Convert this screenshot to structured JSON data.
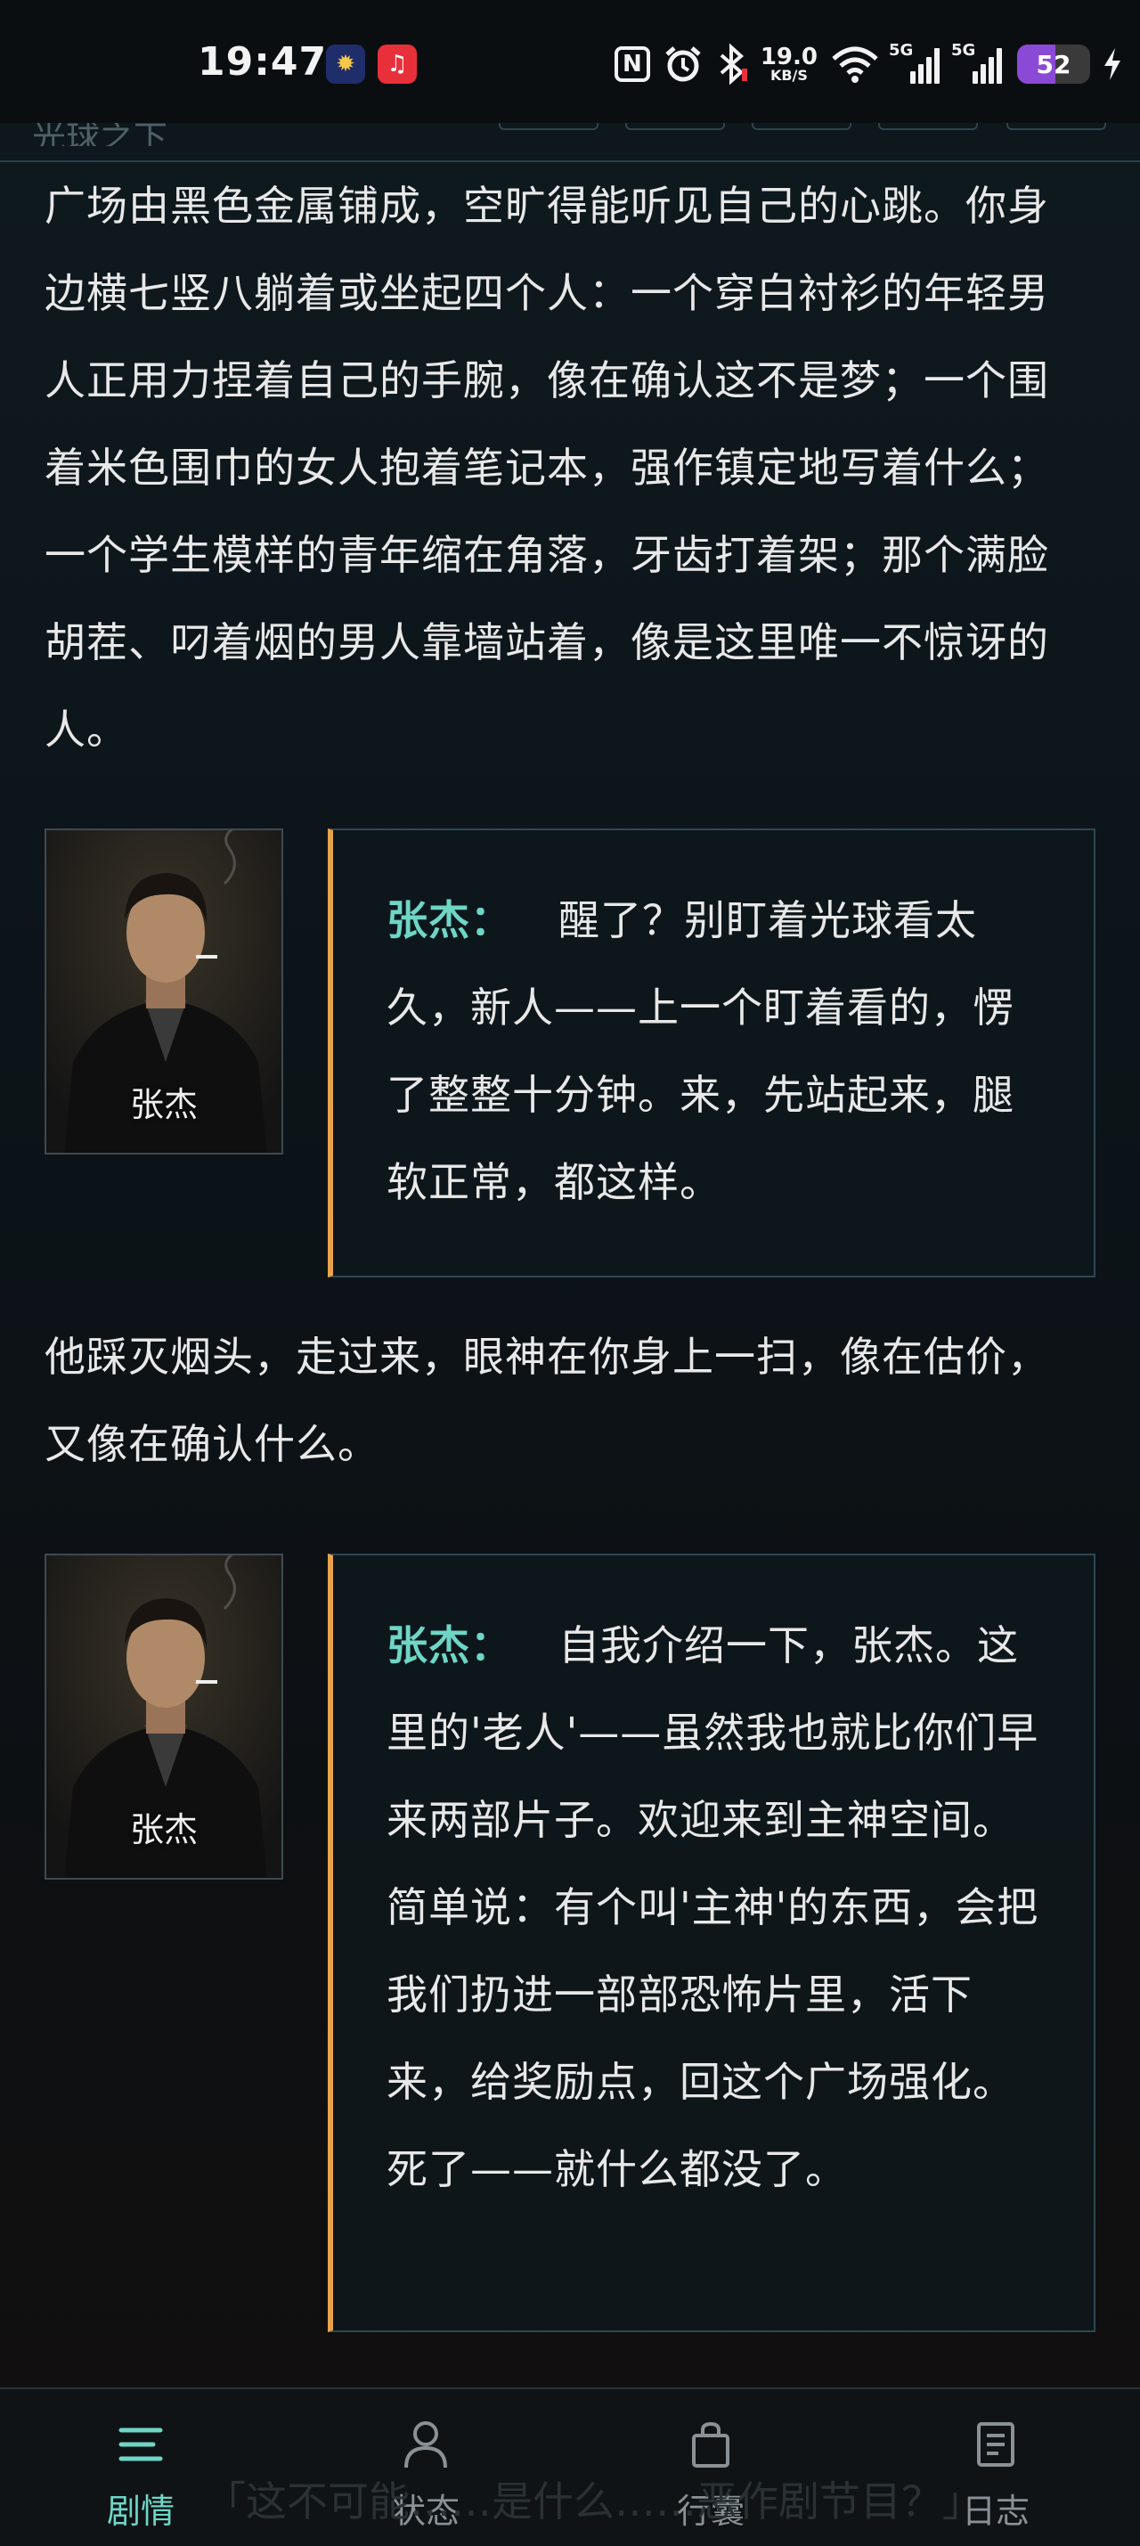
{
  "status_bar": {
    "time": "19:47",
    "net_speed_value": "19.0",
    "net_speed_unit": "KB/S",
    "signal_1_label": "5G",
    "signal_2_label": "5G",
    "battery_level": "52",
    "icons": [
      "news-app-icon",
      "music-app-icon",
      "nfc-icon",
      "alarm-icon",
      "bluetooth-icon",
      "wifi-icon",
      "charging-icon"
    ]
  },
  "header": {
    "title_partial": "光球之下"
  },
  "story": {
    "paragraph_1": "广场由黑色金属铺成，空旷得能听见自己的心跳。你身边横七竖八躺着或坐起四个人：一个穿白衬衫的年轻男人正用力捏着自己的手腕，像在确认这不是梦；一个围着米色围巾的女人抱着笔记本，强作镇定地写着什么；一个学生模样的青年缩在角落，牙齿打着架；那个满脸胡茬、叼着烟的男人靠墙站着，像是这里唯一不惊讶的人。",
    "dialog_1": {
      "portrait_caption": "张杰",
      "speaker": "张杰：",
      "text": "醒了？别盯着光球看太久，新人——上一个盯着看的，愣了整整十分钟。来，先站起来，腿软正常，都这样。"
    },
    "paragraph_2": "他踩灭烟头，走过来，眼神在你身上一扫，像在估价，又像在确认什么。",
    "dialog_2": {
      "portrait_caption": "张杰",
      "speaker": "张杰：",
      "text": "自我介绍一下，张杰。这里的'老人'——虽然我也就比你们早来两部片子。欢迎来到主神空间。简单说：有个叫'主神'的东西，会把我们扔进一部部恐怖片里，活下来，给奖励点，回这个广场强化。死了——就什么都没了。"
    },
    "ghost_bottom_text": "「这不可能……是什么……恶作剧节目？」"
  },
  "bottom_nav": {
    "items": [
      {
        "label": "剧情",
        "icon": "menu-lines-icon",
        "active": true
      },
      {
        "label": "状态",
        "icon": "person-icon",
        "active": false
      },
      {
        "label": "行囊",
        "icon": "bag-icon",
        "active": false
      },
      {
        "label": "日志",
        "icon": "document-icon",
        "active": false
      }
    ]
  },
  "colors": {
    "accent": "#6fd6c6",
    "bubble_border_accent": "#e8a34a",
    "battery": "#8b4ad6"
  }
}
